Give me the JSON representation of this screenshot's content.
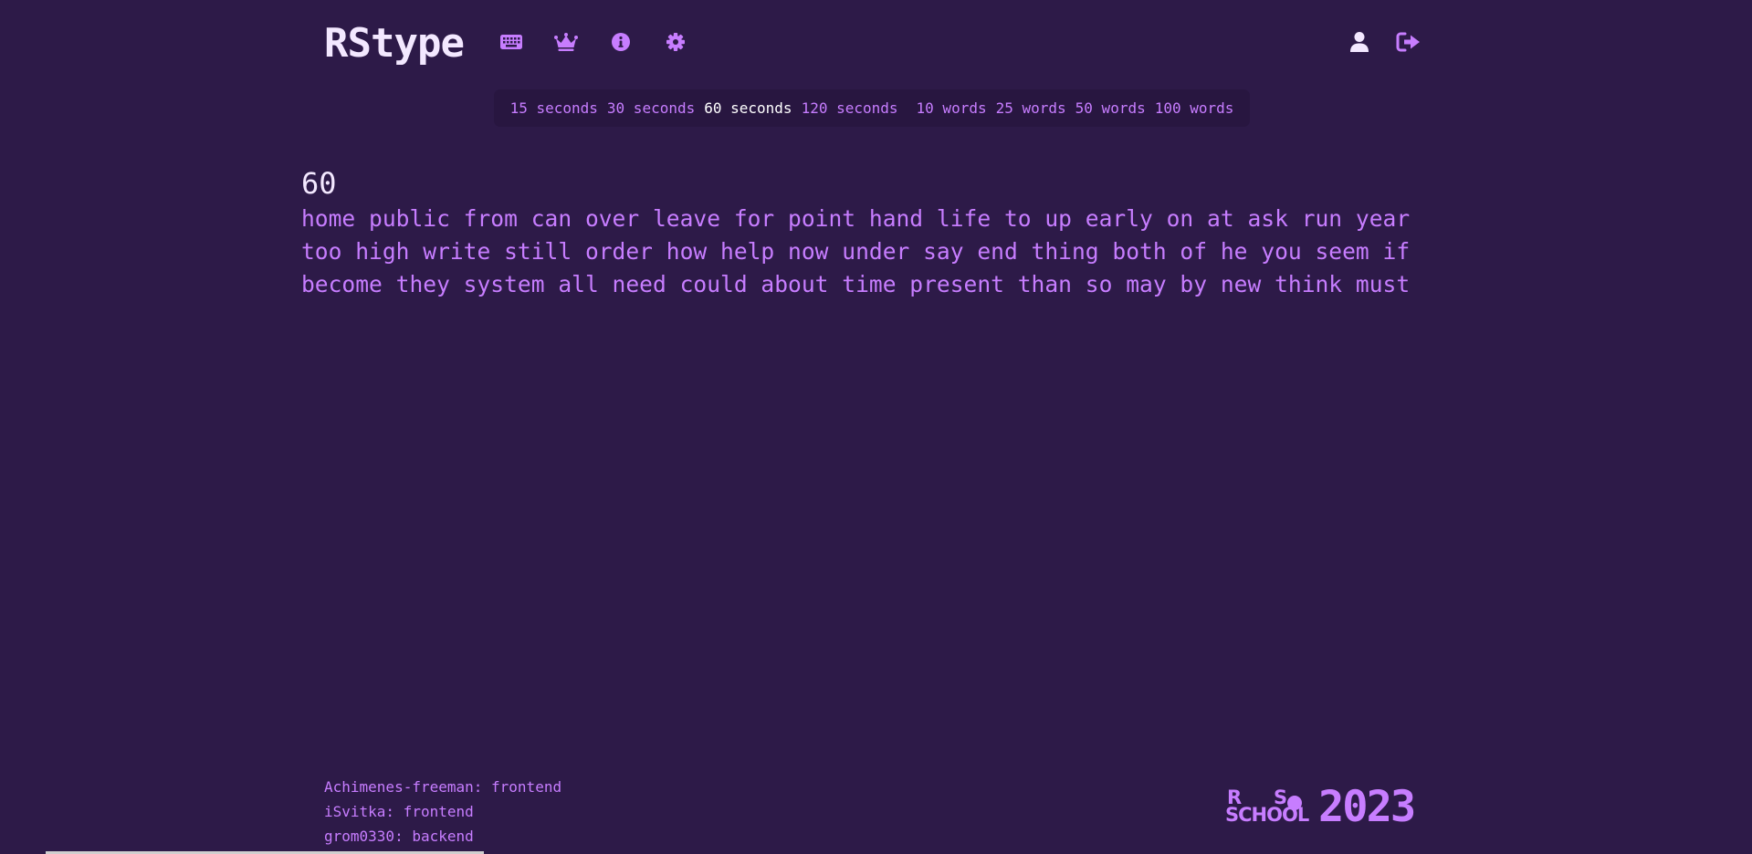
{
  "app": {
    "title": "RStype"
  },
  "header": {
    "nav_icons": [
      "keyboard-icon",
      "crown-icon",
      "info-icon",
      "gear-icon"
    ],
    "right_icons": [
      "user-icon",
      "logout-icon"
    ]
  },
  "modes": {
    "time": [
      "15 seconds",
      "30 seconds",
      "60 seconds",
      "120 seconds"
    ],
    "words": [
      "10 words",
      "25 words",
      "50 words",
      "100 words"
    ],
    "active": "60 seconds"
  },
  "test": {
    "timer": "60",
    "lines": [
      "home public from can over leave for point hand life to up early on at ask run year",
      "too high write still order how help now under say end thing both of he you seem if",
      "become they system all need could about time present than so may by new think must"
    ]
  },
  "footer": {
    "credits": [
      "Achimenes-freeman: frontend",
      "iSvitka: frontend",
      "grom0330: backend"
    ],
    "logo": {
      "r": "R",
      "s": "S",
      "school": "SCHOOL",
      "year": "2023"
    }
  },
  "colors": {
    "background": "#2d1a48",
    "accent": "#c77dff",
    "text_bright": "#f3e8ff",
    "mode_bar_bg": "#281640"
  }
}
